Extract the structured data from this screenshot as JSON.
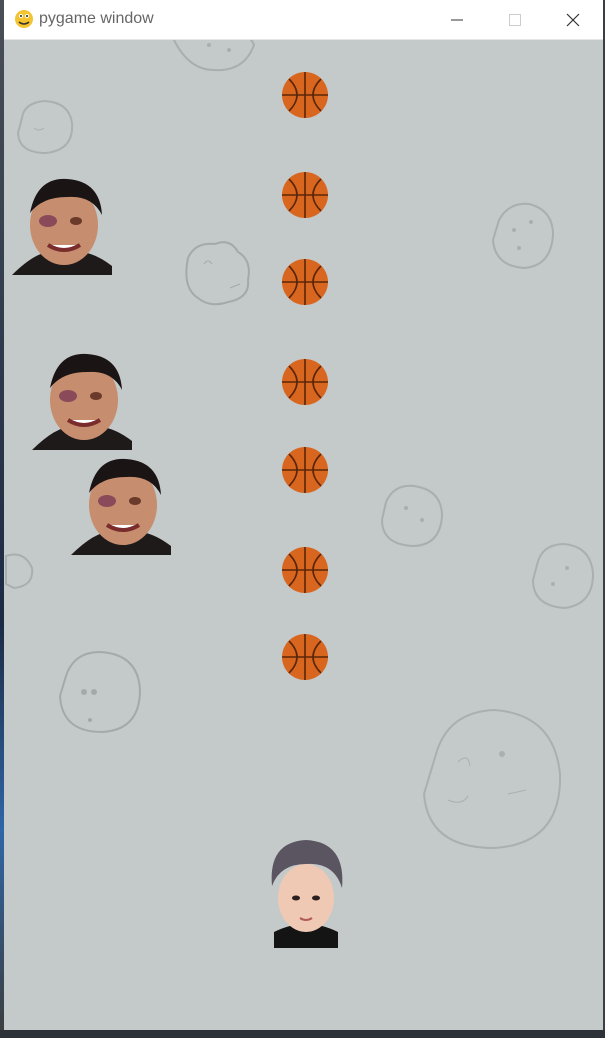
{
  "window": {
    "title": "pygame window",
    "icon": "pygame-snake-icon",
    "controls": [
      "minimize-icon",
      "maximize-icon",
      "close-icon"
    ]
  },
  "scene": {
    "background_color": "#c4c9ca",
    "basketball_count": 7,
    "enemy_count": 3,
    "asteroid_count": 9,
    "player_count": 1
  }
}
